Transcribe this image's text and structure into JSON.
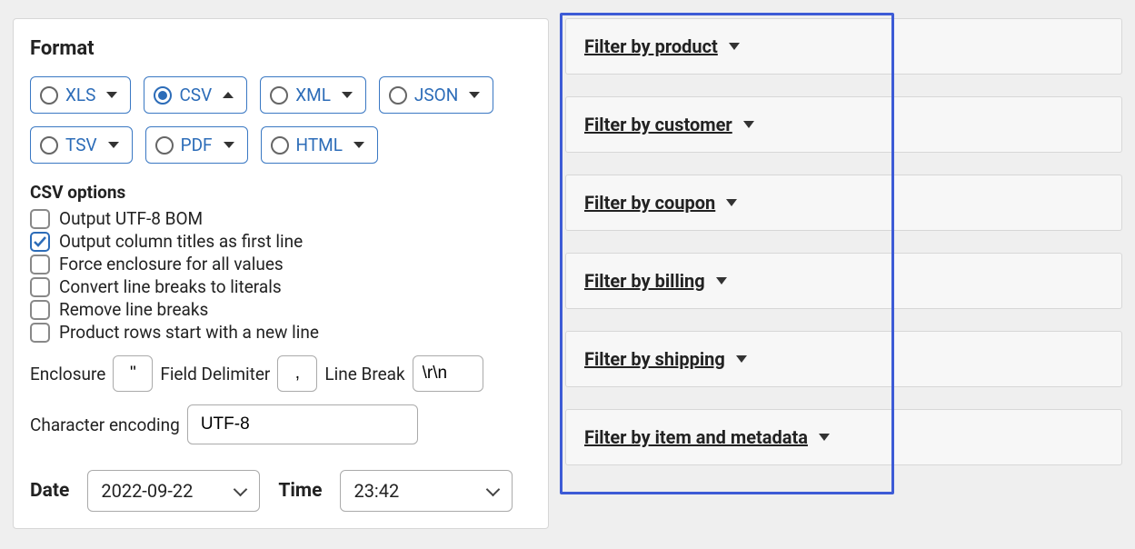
{
  "format": {
    "title": "Format",
    "options": [
      {
        "label": "XLS",
        "selected": false,
        "expanded": false
      },
      {
        "label": "CSV",
        "selected": true,
        "expanded": true
      },
      {
        "label": "XML",
        "selected": false,
        "expanded": false
      },
      {
        "label": "JSON",
        "selected": false,
        "expanded": false
      },
      {
        "label": "TSV",
        "selected": false,
        "expanded": false
      },
      {
        "label": "PDF",
        "selected": false,
        "expanded": false
      },
      {
        "label": "HTML",
        "selected": false,
        "expanded": false
      }
    ]
  },
  "csv_options": {
    "title": "CSV options",
    "checks": [
      {
        "label": "Output UTF-8 BOM",
        "checked": false
      },
      {
        "label": "Output column titles as first line",
        "checked": true
      },
      {
        "label": "Force enclosure for all values",
        "checked": false
      },
      {
        "label": "Convert line breaks to literals",
        "checked": false
      },
      {
        "label": "Remove line breaks",
        "checked": false
      },
      {
        "label": "Product rows start with a new line",
        "checked": false
      }
    ],
    "enclosure_label": "Enclosure",
    "enclosure_value": "\"",
    "delimiter_label": "Field Delimiter",
    "delimiter_value": ",",
    "linebreak_label": "Line Break",
    "linebreak_value": "\\r\\n",
    "encoding_label": "Character encoding",
    "encoding_value": "UTF-8"
  },
  "date": {
    "label": "Date",
    "value": "2022-09-22"
  },
  "time": {
    "label": "Time",
    "value": "23:42"
  },
  "filters": [
    {
      "label": "Filter by product"
    },
    {
      "label": "Filter by customer"
    },
    {
      "label": "Filter by coupon"
    },
    {
      "label": "Filter by billing"
    },
    {
      "label": "Filter by shipping"
    },
    {
      "label": "Filter by item and metadata"
    }
  ]
}
